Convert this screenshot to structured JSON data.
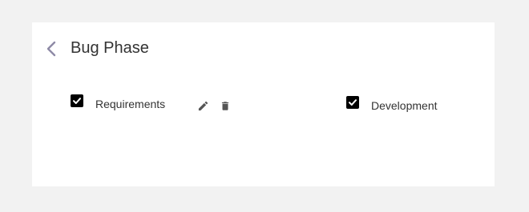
{
  "header": {
    "title": "Bug Phase",
    "back_icon": "chevron-left-icon",
    "back_icon_color": "#8e8aa6"
  },
  "phases": [
    {
      "label": "Requirements",
      "checked": true,
      "actions": [
        "edit-icon",
        "delete-icon"
      ]
    },
    {
      "label": "Development",
      "checked": true
    }
  ],
  "colors": {
    "page_bg": "#f2f2f2",
    "card_bg": "#ffffff",
    "text": "#333333",
    "checkbox": "#000000",
    "action_icon": "#555555"
  }
}
